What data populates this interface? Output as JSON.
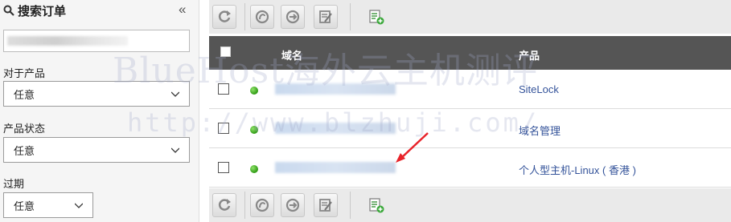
{
  "sidebar": {
    "title": "搜索订单",
    "collapse_icon": "double-chevron-left-icon",
    "filters": [
      {
        "label": "对于产品",
        "value": "任意"
      },
      {
        "label": "产品状态",
        "value": "任意"
      },
      {
        "label": "过期",
        "value": "任意"
      }
    ]
  },
  "toolbar": {
    "buttons": [
      "refresh-icon",
      "renew-icon",
      "transfer-icon",
      "edit-list-icon",
      "checklist-add-icon"
    ]
  },
  "table": {
    "headers": {
      "domain": "域名",
      "product": "产品"
    },
    "rows": [
      {
        "product": "SiteLock"
      },
      {
        "product": "域名管理"
      },
      {
        "product": "个人型主机-Linux ( 香港 )"
      }
    ]
  },
  "watermark": {
    "line1": "BlueHost海外云主机测评",
    "line2": "http://www.blzhuji.com/"
  },
  "colors": {
    "header_bg": "#555555",
    "link": "#34539a",
    "status_dot": "#2f9a14"
  }
}
